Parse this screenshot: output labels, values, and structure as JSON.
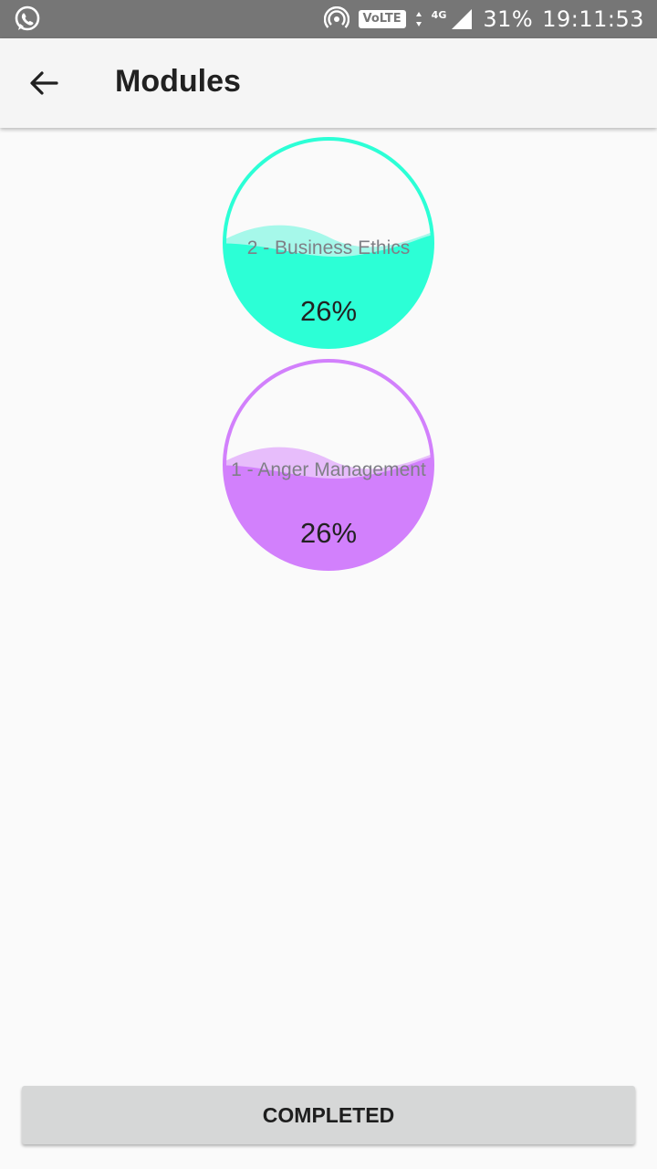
{
  "status_bar": {
    "left_icons": [
      "whatsapp-icon"
    ],
    "right_icons": [
      "hotspot-icon",
      "volte-icon",
      "data-arrows-icon",
      "signal-icon"
    ],
    "volte_label": "VoLTE",
    "network_label": "4G",
    "battery": "31%",
    "time": "19:11:53"
  },
  "app_bar": {
    "back_icon": "arrow-left-icon",
    "title": "Modules"
  },
  "modules": [
    {
      "name": "2 - Business Ethics",
      "percent_label": "26%",
      "progress": 0.26,
      "color": "#2cffd6",
      "wave_light": "#a6f8ea"
    },
    {
      "name": "1 - Anger Management",
      "percent_label": "26%",
      "progress": 0.26,
      "color": "#d280fc",
      "wave_light": "#e7bdfb"
    }
  ],
  "footer": {
    "completed_label": "COMPLETED",
    "button_color": "#d6d7d7"
  }
}
